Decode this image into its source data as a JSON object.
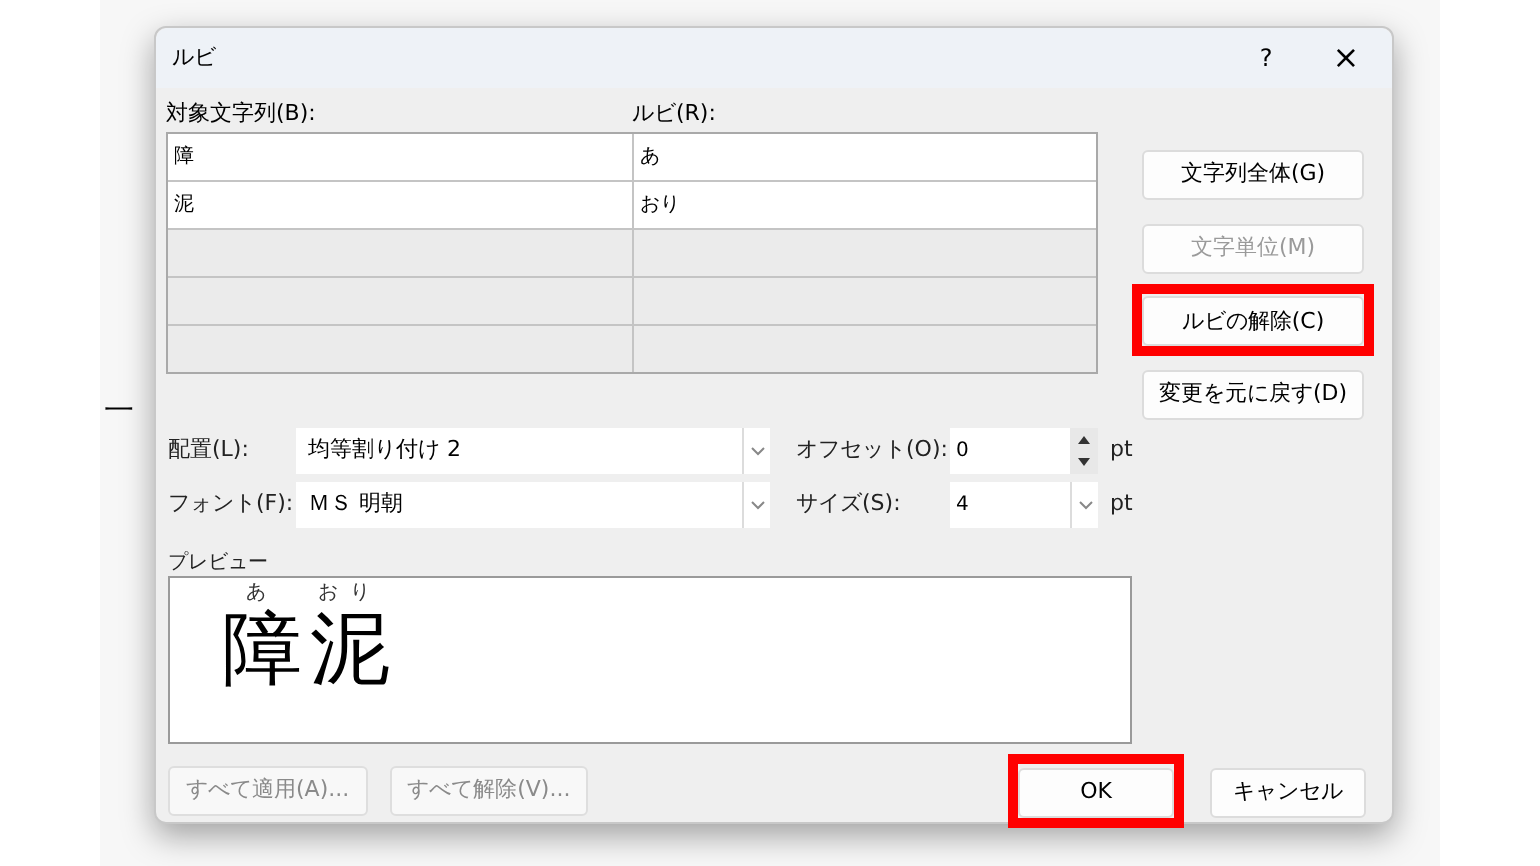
{
  "background_text": "一",
  "window": {
    "title": "ルビ",
    "help": "?",
    "close": "×"
  },
  "grid": {
    "columns": [
      "対象文字列(B):",
      "ルビ(R):"
    ],
    "rows": [
      {
        "base": "障",
        "ruby": "あ",
        "enabled": true
      },
      {
        "base": "泥",
        "ruby": "おり",
        "enabled": true
      },
      {
        "enabled": false
      },
      {
        "enabled": false
      },
      {
        "enabled": false
      }
    ]
  },
  "side_buttons": [
    {
      "label": "文字列全体(G)",
      "disabled": false,
      "highlighted": false
    },
    {
      "label": "文字単位(M)",
      "disabled": true,
      "highlighted": false
    },
    {
      "label": "ルビの解除(C)",
      "disabled": false,
      "highlighted": true
    },
    {
      "label": "変更を元に戻す(D)",
      "disabled": false,
      "highlighted": false
    }
  ],
  "settings": [
    {
      "label": "配置(L):",
      "value": "均等割り付け 2",
      "side_label": "オフセット(O):",
      "side_value": "0",
      "kind": "spin",
      "unit": "pt"
    },
    {
      "label": "フォント(F):",
      "value": "ＭＳ 明朝",
      "side_label": "サイズ(S):",
      "side_value": "4",
      "kind": "combo",
      "unit": "pt"
    }
  ],
  "preview": {
    "label": "プレビュー",
    "chars": [
      {
        "base": "障",
        "ruby": "あ"
      },
      {
        "base": "泥",
        "ruby": "おり"
      }
    ]
  },
  "footer_left": [
    {
      "label": "すべて適用(A)...",
      "disabled": true
    },
    {
      "label": "すべて解除(V)...",
      "disabled": true
    }
  ],
  "footer_right": [
    {
      "label": "OK",
      "highlighted": true
    },
    {
      "label": "キャンセル",
      "highlighted": false
    }
  ]
}
